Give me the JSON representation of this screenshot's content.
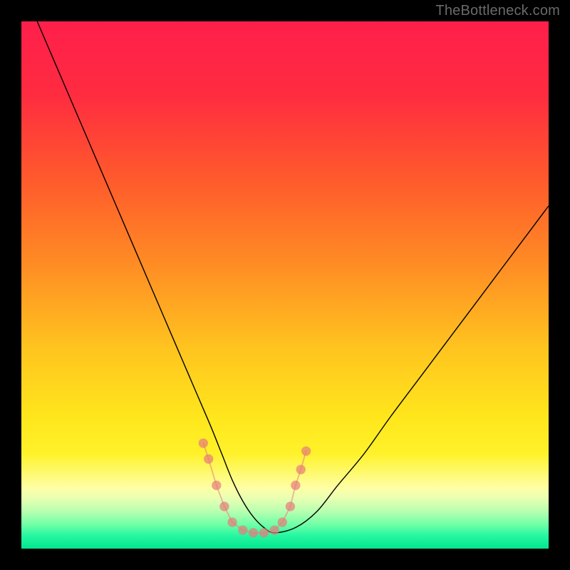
{
  "watermark": "TheBottleneck.com",
  "chart_data": {
    "type": "line",
    "title": "",
    "xlabel": "",
    "ylabel": "",
    "xlim": [
      0,
      100
    ],
    "ylim": [
      0,
      100
    ],
    "gradient_stops": [
      {
        "offset": 0,
        "color": "#ff1f4b"
      },
      {
        "offset": 0.14,
        "color": "#ff2c40"
      },
      {
        "offset": 0.3,
        "color": "#ff5a2c"
      },
      {
        "offset": 0.46,
        "color": "#ff8c24"
      },
      {
        "offset": 0.62,
        "color": "#ffc41f"
      },
      {
        "offset": 0.75,
        "color": "#ffe61c"
      },
      {
        "offset": 0.82,
        "color": "#fff22a"
      },
      {
        "offset": 0.885,
        "color": "#feffa6"
      },
      {
        "offset": 0.905,
        "color": "#e8ffb2"
      },
      {
        "offset": 0.93,
        "color": "#b6ffb0"
      },
      {
        "offset": 0.955,
        "color": "#6effa6"
      },
      {
        "offset": 0.975,
        "color": "#27f7a1"
      },
      {
        "offset": 1.0,
        "color": "#02e68e"
      }
    ],
    "series": [
      {
        "name": "bottleneck-curve",
        "x": [
          3,
          6,
          9,
          12,
          15,
          18,
          21,
          24,
          27,
          30,
          33,
          36,
          38,
          40,
          42,
          44,
          46,
          48,
          52,
          56,
          60,
          65,
          70,
          76,
          82,
          88,
          94,
          100
        ],
        "y": [
          100,
          93,
          86,
          79,
          72,
          65,
          58,
          51,
          44,
          37,
          30,
          23,
          18,
          13,
          9,
          6,
          4,
          3,
          4,
          7,
          12,
          18,
          25,
          33,
          41,
          49,
          57,
          65
        ]
      }
    ],
    "marker_band": {
      "color": "#e77b7b",
      "circle_radius": 0.9,
      "stroke_width": 1.8,
      "points": [
        {
          "x": 34.5,
          "y": 20.0
        },
        {
          "x": 35.5,
          "y": 17.0
        },
        {
          "x": 37.0,
          "y": 12.0
        },
        {
          "x": 38.5,
          "y": 8.0
        },
        {
          "x": 40.0,
          "y": 5.0
        },
        {
          "x": 42.0,
          "y": 3.5
        },
        {
          "x": 44.0,
          "y": 3.0
        },
        {
          "x": 46.0,
          "y": 3.0
        },
        {
          "x": 48.0,
          "y": 3.5
        },
        {
          "x": 49.5,
          "y": 5.0
        },
        {
          "x": 51.0,
          "y": 8.0
        },
        {
          "x": 52.0,
          "y": 12.0
        },
        {
          "x": 53.0,
          "y": 15.0
        },
        {
          "x": 54.0,
          "y": 18.5
        }
      ]
    }
  }
}
